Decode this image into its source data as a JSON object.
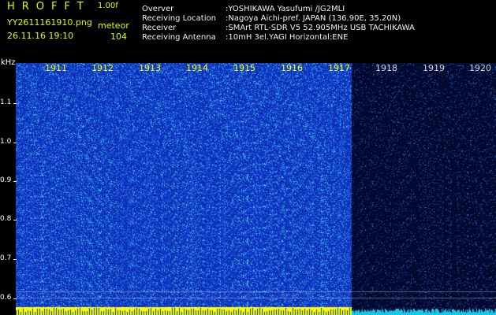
{
  "header": {
    "app_name": "HROFFT",
    "app_version": "1.00f",
    "filename": "YY2611161910.png",
    "mode": "meteor",
    "datetime": "26.11.16 19:10",
    "count": "104"
  },
  "info": [
    {
      "label": "Overver",
      "value": ":YOSHIKAWA Yasufumi /JG2MLI"
    },
    {
      "label": "Receiving Location",
      "value": ":Nagoya Aichi-pref. JAPAN (136.90E, 35.20N)"
    },
    {
      "label": "Receiver",
      "value": ":SMArt RTL-SDR V5 52.905MHz USB TACHIKAWA"
    },
    {
      "label": "Receiving Antenna",
      "value": ":10mH 3el.YAGI Horizontal:ENE"
    }
  ],
  "spectrogram": {
    "freq_unit": "kHz",
    "freq_labels": [
      "1.1",
      "1.0",
      "0.9",
      "0.8",
      "0.7",
      "0.6"
    ],
    "time_labels": [
      "1911",
      "1912",
      "1913",
      "1914",
      "1915",
      "1916",
      "1917",
      "1918",
      "1919",
      "1920"
    ],
    "colors": {
      "active_bg": "#0d2fb8",
      "quiet_bg": "#03082e",
      "noise": "#38b8e6",
      "baseline": "#ffff00"
    },
    "active_until_fraction": 0.7
  }
}
